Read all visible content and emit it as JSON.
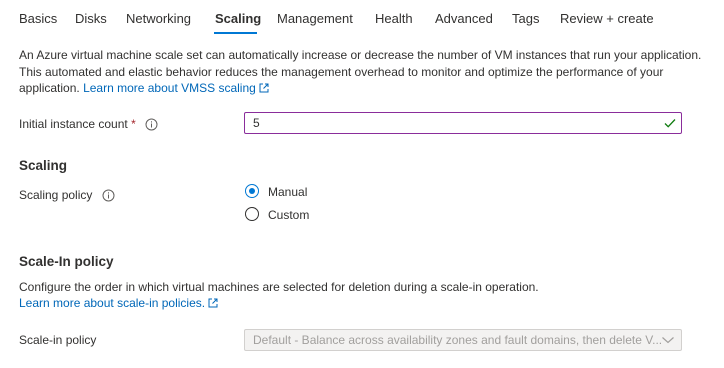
{
  "tabs": [
    "Basics",
    "Disks",
    "Networking",
    "Scaling",
    "Management",
    "Health",
    "Advanced",
    "Tags",
    "Review + create"
  ],
  "active_tab": "Scaling",
  "description": {
    "text": "An Azure virtual machine scale set can automatically increase or decrease the number of VM instances that run your application. This automated and elastic behavior reduces the management overhead to monitor and optimize the performance of your application.",
    "link": "Learn more about VMSS scaling"
  },
  "initial_count": {
    "label": "Initial instance count",
    "required_mark": "*",
    "value": "5"
  },
  "scaling": {
    "title": "Scaling",
    "policy_label": "Scaling policy",
    "options": [
      "Manual",
      "Custom"
    ],
    "selected": "Manual"
  },
  "scale_in": {
    "title": "Scale-In policy",
    "description": "Configure the order in which virtual machines are selected for deletion during a scale-in operation.",
    "link": "Learn more about scale-in policies.",
    "policy_label": "Scale-in policy",
    "policy_value": "Default - Balance across availability zones and fault domains, then delete V..."
  },
  "colors": {
    "accent": "#0078d4",
    "link": "#0067b8",
    "input_border_focus": "#8a2d9b",
    "valid_check": "#107c10",
    "required": "#a4262c"
  },
  "icons": {
    "external_link": "external-link-icon",
    "info": "info-icon",
    "check": "check-icon",
    "dropdown": "chevron-down-icon"
  }
}
